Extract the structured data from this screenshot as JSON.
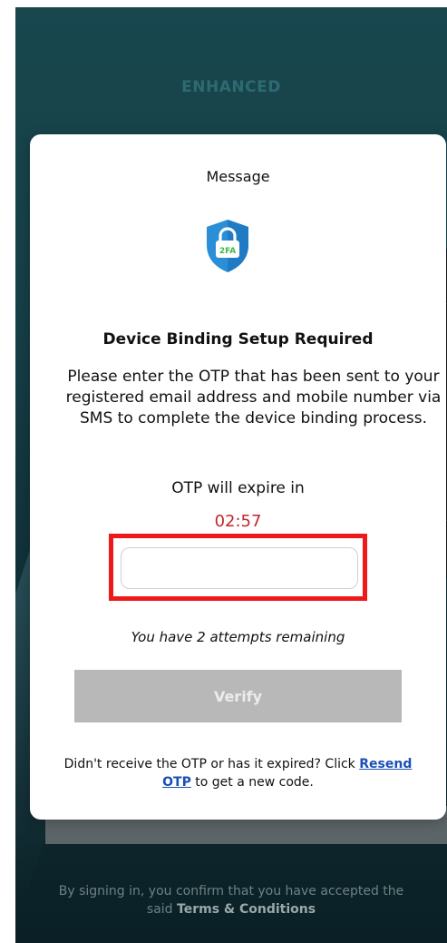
{
  "background": {
    "brand_label": "ENHANCED",
    "footer_prefix": "By signing in, you confirm that you have accepted the said ",
    "footer_terms_link": "Terms & Conditions"
  },
  "modal": {
    "title": "Message",
    "icon": {
      "name": "shield-lock-2fa-icon",
      "badge_text": "2FA"
    },
    "heading": "Device Binding Setup Required",
    "body": "Please enter the OTP that has been sent to your registered email address and mobile number via SMS to complete the device binding process.",
    "otp_expire_label": "OTP will expire in",
    "otp_timer": "02:57",
    "otp_input": {
      "value": "",
      "placeholder": ""
    },
    "attempts_text": "You have 2 attempts remaining",
    "verify_label": "Verify",
    "resend_prefix": "Didn't receive the OTP or has it expired? Click ",
    "resend_link": "Resend OTP",
    "resend_suffix": " to get a new code."
  },
  "colors": {
    "timer": "#c0262d",
    "highlight": "#ee1a1a",
    "link": "#1a4fb8",
    "verify_disabled": "#b8b8b8",
    "shield": "#2a8fd6"
  }
}
